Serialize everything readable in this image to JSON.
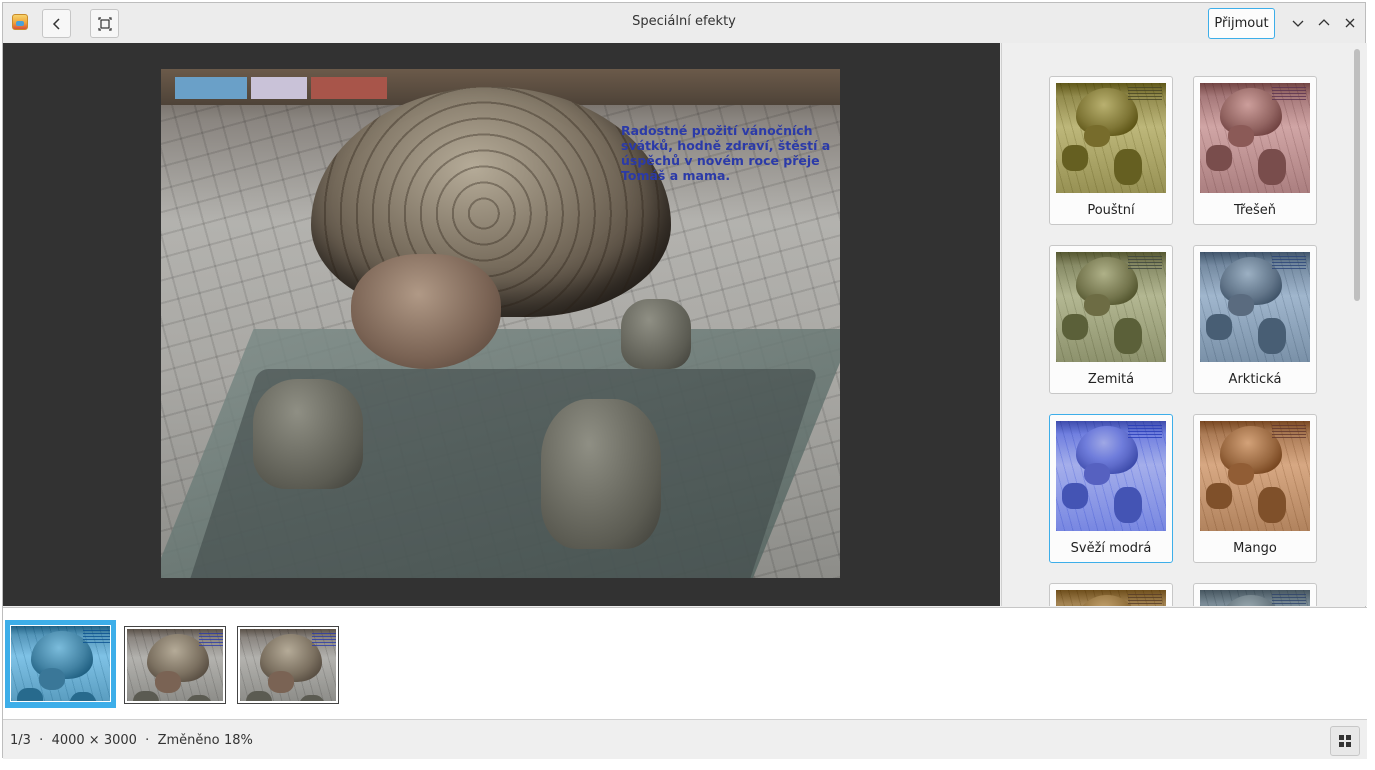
{
  "window": {
    "title": "Speciální efekty",
    "app_icon": "image-viewer-app-icon"
  },
  "toolbar": {
    "back_icon": "chevron-left-icon",
    "fit_icon": "fit-to-window-icon",
    "accept_label": "Přijmout"
  },
  "window_controls": {
    "minimize_icon": "chevron-down-icon",
    "maximize_icon": "chevron-up-icon",
    "close_icon": "close-icon"
  },
  "image": {
    "overlay_text": "Radostné prožití vánočních svátků, hodně zdraví, štěstí a úspěchů v novém roce přeje Tomáš a mama."
  },
  "effects": [
    {
      "label": "Pouštní",
      "tint": "#c8c070",
      "selected": false
    },
    {
      "label": "Třešeň",
      "tint": "#c48a8c",
      "selected": false
    },
    {
      "label": "Zemitá",
      "tint": "#9aa070",
      "selected": false
    },
    {
      "label": "Arktická",
      "tint": "#8aa8c8",
      "selected": false
    },
    {
      "label": "Svěží modrá",
      "tint": "#3f55d8",
      "selected": true
    },
    {
      "label": "Mango",
      "tint": "#b87a4a",
      "selected": false
    },
    {
      "label": "",
      "tint": "#c8a060",
      "selected": false
    },
    {
      "label": "",
      "tint": "#88a0b0",
      "selected": false
    }
  ],
  "filmstrip": {
    "items": [
      {
        "tint": "#4aa3d4",
        "selected": true
      },
      {
        "tint": "",
        "selected": false
      },
      {
        "tint": "",
        "selected": false
      }
    ]
  },
  "status": {
    "info": "1/3  ·  4000 × 3000  ·  Změněno",
    "zoom": "18%",
    "grid_icon": "grid-view-icon"
  },
  "colors": {
    "accent": "#3daee9",
    "viewer_bg": "#323232",
    "overlay_text": "#2b3aa8"
  }
}
